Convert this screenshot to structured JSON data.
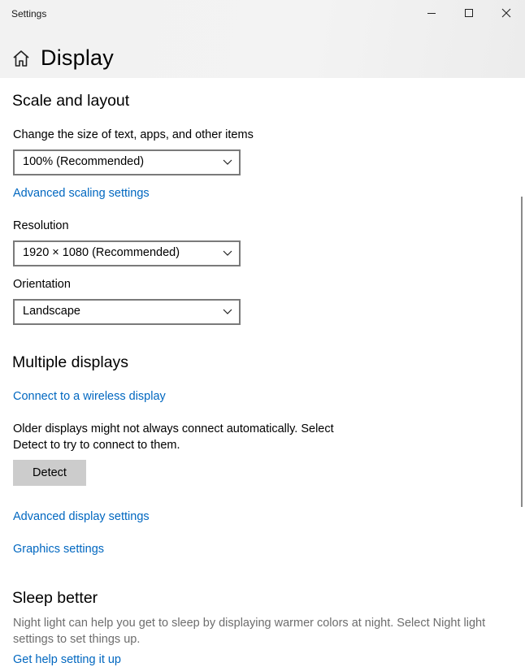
{
  "window": {
    "app_title": "Settings",
    "controls": [
      "minimize-icon",
      "maximize-icon",
      "close-icon"
    ]
  },
  "header": {
    "home_icon": "home-icon",
    "title": "Display"
  },
  "scale_layout": {
    "heading": "Scale and layout",
    "size_label": "Change the size of text, apps, and other items",
    "size_value": "100% (Recommended)",
    "advanced_scaling_link": "Advanced scaling settings",
    "resolution_label": "Resolution",
    "resolution_value": "1920 × 1080 (Recommended)",
    "orientation_label": "Orientation",
    "orientation_value": "Landscape"
  },
  "multiple_displays": {
    "heading": "Multiple displays",
    "wireless_link": "Connect to a wireless display",
    "older_text_line1": "Older displays might not always connect automatically. Select",
    "older_text_line2": "Detect to try to connect to them.",
    "detect_button": "Detect",
    "advanced_display_link": "Advanced display settings",
    "graphics_link": "Graphics settings"
  },
  "sleep_better": {
    "heading": "Sleep better",
    "text_line1": "Night light can help you get to sleep by displaying warmer colors at night. Select Night light",
    "text_line2": "settings to set things up.",
    "help_link": "Get help setting it up"
  },
  "colors": {
    "link": "#0067c0",
    "button_bg": "#cccccc",
    "dropdown_border": "#7a7a7a",
    "muted_text": "#6d6d6d"
  }
}
